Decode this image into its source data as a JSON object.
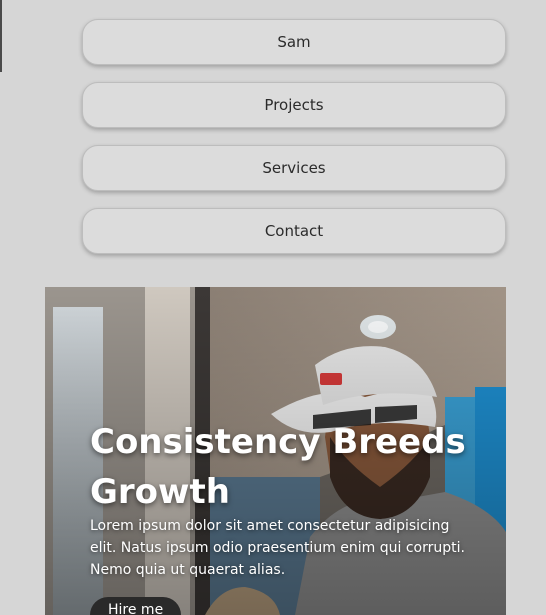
{
  "nav": {
    "items": [
      {
        "label": "Sam"
      },
      {
        "label": "Projects"
      },
      {
        "label": "Services"
      },
      {
        "label": "Contact"
      }
    ]
  },
  "hero": {
    "title": "Consistency Breeds Growth",
    "description": "Lorem ipsum dolor sit amet consectetur adipisicing elit. Natus ipsum odio praesentium enim qui corrupti. Nemo quia ut quaerat alias.",
    "cta_label": "Hire me"
  },
  "colors": {
    "page_background": "#d6d6d6",
    "nav_button": "#dcdcdc",
    "cta_background": "#2a2a2a",
    "hero_text": "#ffffff"
  }
}
